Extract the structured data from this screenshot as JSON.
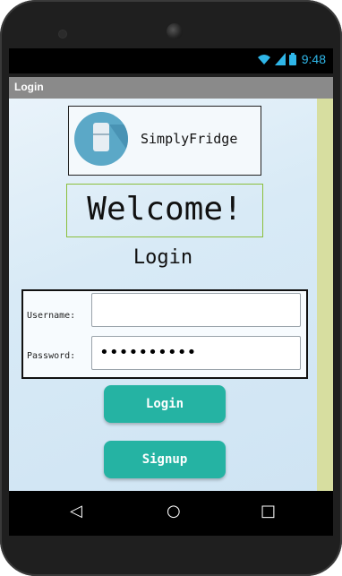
{
  "status_bar": {
    "time": "9:48",
    "icons": [
      "wifi-icon",
      "signal-icon",
      "battery-icon"
    ],
    "accent_color": "#2fb6e8"
  },
  "title_bar": {
    "title": "Login"
  },
  "logo": {
    "text": "SimplyFridge",
    "icon": "fridge-icon"
  },
  "welcome": {
    "text": "Welcome!"
  },
  "login_heading": "Login",
  "form": {
    "username_label": "Username:",
    "username_value": "",
    "password_label": "Password:",
    "password_value": "••••••••••"
  },
  "buttons": {
    "login_label": "Login",
    "signup_label": "Signup",
    "color": "#25b3a3"
  },
  "nav": {
    "back_icon": "◁",
    "home_icon": "○",
    "recents_icon": "□"
  }
}
